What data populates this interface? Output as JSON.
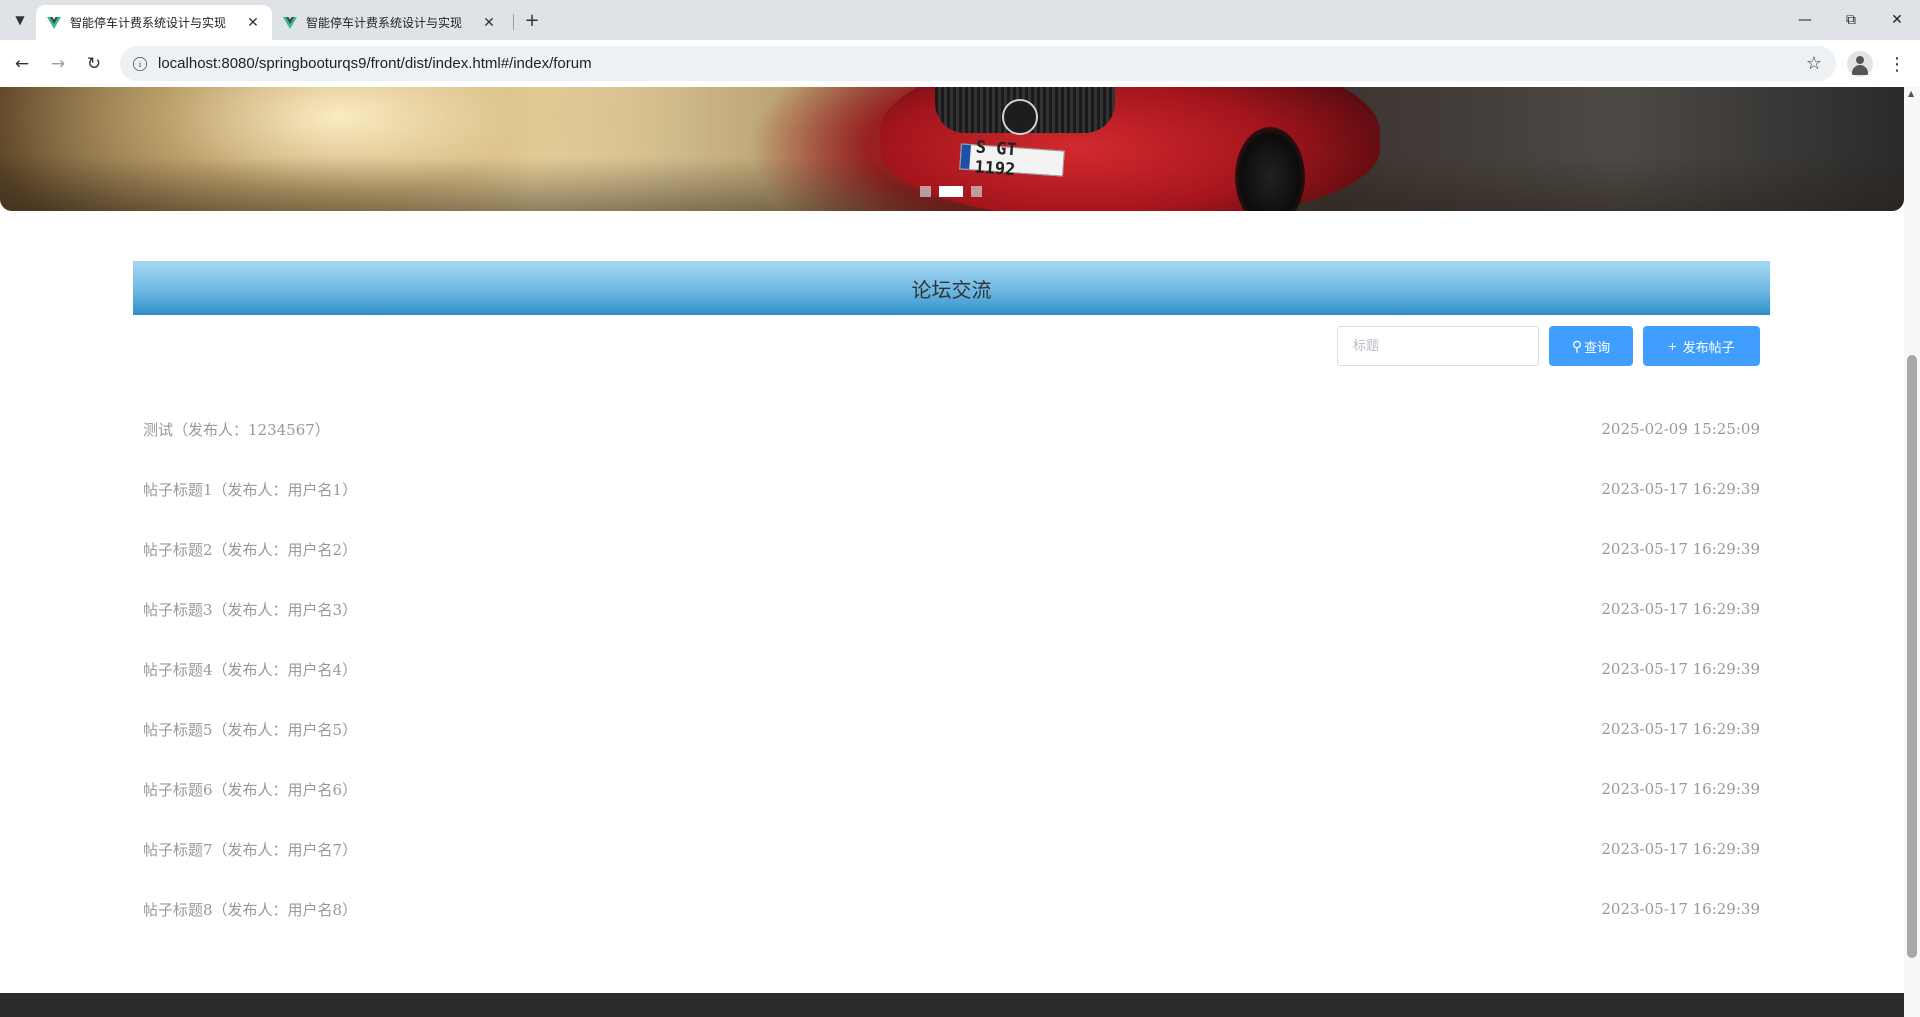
{
  "browser": {
    "tabs": [
      {
        "title": "智能停车计费系统设计与实现",
        "active": true
      },
      {
        "title": "智能停车计费系统设计与实现",
        "active": false
      }
    ],
    "url": "localhost:8080/springbooturqs9/front/dist/index.html#/index/forum",
    "icons": {
      "tab_list": "chevron-down-icon",
      "close": "close-icon",
      "new_tab": "plus-icon",
      "back": "arrow-left-icon",
      "forward": "arrow-right-icon",
      "reload": "reload-icon",
      "site_info": "info-icon",
      "bookmark": "star-icon",
      "profile": "profile-icon",
      "menu": "kebab-icon",
      "minimize": "minimize-icon",
      "restore": "restore-icon",
      "window_close": "close-icon"
    }
  },
  "banner": {
    "plate_text": "S GT 1192",
    "slides": 3,
    "active_slide": 2
  },
  "forum": {
    "heading": "论坛交流",
    "search": {
      "placeholder": "标题",
      "value": ""
    },
    "query_button": "查询",
    "post_button": "发布帖子",
    "posts": [
      {
        "title": "测试（发布人：1234567）",
        "time": "2025-02-09 15:25:09"
      },
      {
        "title": "帖子标题1（发布人：用户名1）",
        "time": "2023-05-17 16:29:39"
      },
      {
        "title": "帖子标题2（发布人：用户名2）",
        "time": "2023-05-17 16:29:39"
      },
      {
        "title": "帖子标题3（发布人：用户名3）",
        "time": "2023-05-17 16:29:39"
      },
      {
        "title": "帖子标题4（发布人：用户名4）",
        "time": "2023-05-17 16:29:39"
      },
      {
        "title": "帖子标题5（发布人：用户名5）",
        "time": "2023-05-17 16:29:39"
      },
      {
        "title": "帖子标题6（发布人：用户名6）",
        "time": "2023-05-17 16:29:39"
      },
      {
        "title": "帖子标题7（发布人：用户名7）",
        "time": "2023-05-17 16:29:39"
      },
      {
        "title": "帖子标题8（发布人：用户名8）",
        "time": "2023-05-17 16:29:39"
      }
    ]
  },
  "colors": {
    "primary_button": "#409eff",
    "header_gradient_top": "#a7d8f2",
    "header_gradient_bottom": "#2e8ec8",
    "post_text": "#999999",
    "footer": "#2c2c2c"
  }
}
